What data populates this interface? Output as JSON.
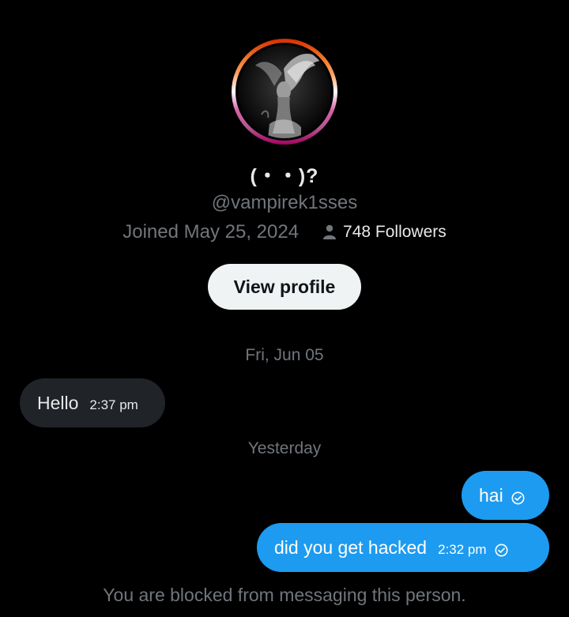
{
  "profile": {
    "display_name": "(・・)?",
    "handle": "@vampirek1sses",
    "joined": "Joined May 25, 2024",
    "followers": "748 Followers",
    "avatar_ring_colors": [
      "#d62e00",
      "#ef7627",
      "#ff9a56",
      "#ffffff",
      "#d462a5",
      "#b55690",
      "#a30262"
    ]
  },
  "actions": {
    "view_profile_label": "View profile"
  },
  "conversation": {
    "date_separators": [
      "Fri, Jun 05",
      "Yesterday"
    ],
    "messages": [
      {
        "direction": "incoming",
        "text": "Hello",
        "time": "2:37 pm"
      },
      {
        "direction": "outgoing",
        "text": "hai",
        "time": "",
        "status_icon": "sent-check-icon"
      },
      {
        "direction": "outgoing",
        "text": "did you get hacked",
        "time": "2:32 pm",
        "status_icon": "sent-check-icon"
      }
    ],
    "blocked_notice": "You are blocked from messaging this person."
  },
  "colors": {
    "background": "#000000",
    "outgoing_bubble": "#1d9bf0",
    "incoming_bubble": "#202327",
    "muted_text": "#71767b",
    "button_bg": "#eff3f4"
  }
}
